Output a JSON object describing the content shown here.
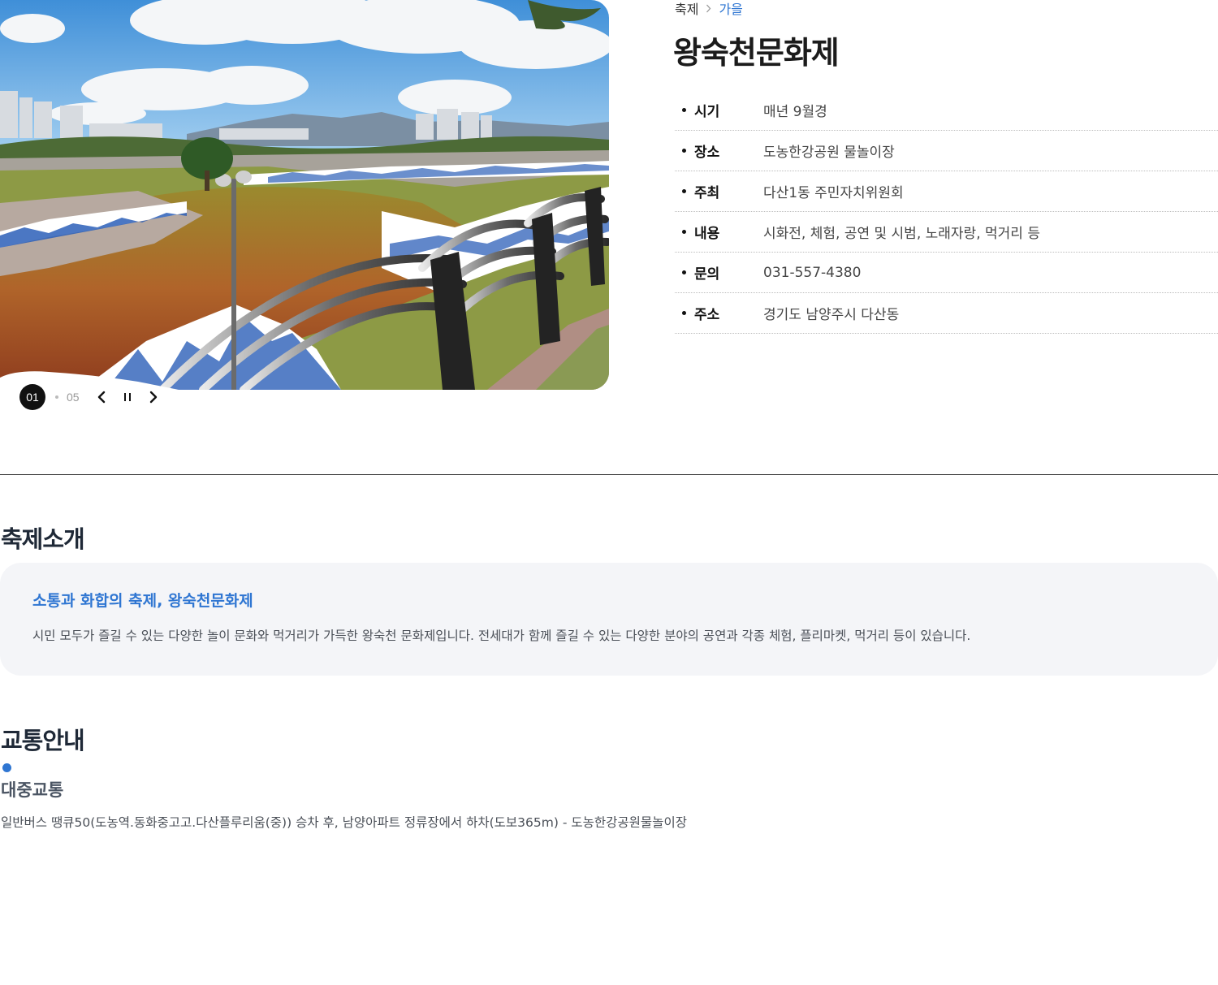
{
  "photo": {
    "alt": "",
    "current_slide": "01",
    "total_slides": "05"
  },
  "breadcrumb": {
    "home": "축제",
    "current": "가을"
  },
  "festival": {
    "title": "왕숙천문화제",
    "info": [
      {
        "key": "시기",
        "value": "매년 9월경"
      },
      {
        "key": "장소",
        "value": "도농한강공원 물놀이장"
      },
      {
        "key": "주최",
        "value": "다산1동 주민자치위원회"
      },
      {
        "key": "내용",
        "value": "시화전, 체험, 공연 및 시범, 노래자랑, 먹거리 등"
      },
      {
        "key": "문의",
        "value": "031-557-4380"
      },
      {
        "key": "주소",
        "value": "경기도 남양주시 다산동"
      }
    ]
  },
  "intro": {
    "section_title": "축제소개",
    "headline": "소통과 화합의 축제, 왕숙천문화제",
    "text": "시민 모두가 즐길 수 있는 다양한 놀이 문화와 먹거리가 가득한 왕숙천 문화제입니다. 전세대가 함께 즐길 수 있는 다양한 분야의 공연과 각종 체험, 플리마켓, 먹거리 등이 있습니다."
  },
  "transport": {
    "section_title": "교통안내",
    "subtitle": "대중교통",
    "text": "일반버스 땡큐50(도농역.동화중고고.다산플루리움(중)) 승차 후, 남양아파트 정류장에서 하차(도보365m) - 도농한강공원물놀이장"
  },
  "colors": {
    "accent": "#2f76d2",
    "title": "#1b1b1b",
    "box_bg": "#f4f5f8"
  },
  "icons": {
    "prev": "chevron-left-icon",
    "pause": "pause-icon",
    "next": "chevron-right-icon",
    "crumb_separator": "chevron-right-icon"
  }
}
